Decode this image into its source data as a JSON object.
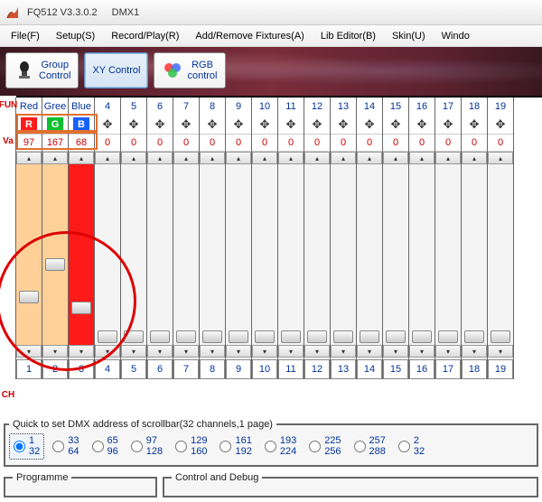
{
  "title": "FQ512 V3.3.0.2",
  "subtitle": "DMX1",
  "menu": {
    "file": "File(F)",
    "setup": "Setup(S)",
    "record": "Record/Play(R)",
    "fixtures": "Add/Remove Fixtures(A)",
    "libeditor": "Lib Editor(B)",
    "skin": "Skin(U)",
    "window": "Windo"
  },
  "toolbar": {
    "group": "Group\nControl",
    "xy": "XY Control",
    "rgb": "RGB\ncontrol"
  },
  "side_labels": {
    "fun": "FUN",
    "val": "Va",
    "ch": "CH"
  },
  "rgb_cols": [
    {
      "name": "Red",
      "letter": "R",
      "bg": "#ff1a1a",
      "value": "97",
      "thumb_pct": 70,
      "track_class": "orange"
    },
    {
      "name": "Gree",
      "letter": "G",
      "bg": "#0bbf2f",
      "value": "167",
      "thumb_pct": 52,
      "track_class": "orange"
    },
    {
      "name": "Blue",
      "letter": "B",
      "bg": "#1560ff",
      "value": "68",
      "thumb_pct": 76,
      "track_class": "red"
    }
  ],
  "num_cols": [
    {
      "n": "4",
      "v": "0"
    },
    {
      "n": "5",
      "v": "0"
    },
    {
      "n": "6",
      "v": "0"
    },
    {
      "n": "7",
      "v": "0"
    },
    {
      "n": "8",
      "v": "0"
    },
    {
      "n": "9",
      "v": "0"
    },
    {
      "n": "10",
      "v": "0"
    },
    {
      "n": "11",
      "v": "0"
    },
    {
      "n": "12",
      "v": "0"
    },
    {
      "n": "13",
      "v": "0"
    },
    {
      "n": "14",
      "v": "0"
    },
    {
      "n": "15",
      "v": "0"
    },
    {
      "n": "16",
      "v": "0"
    },
    {
      "n": "17",
      "v": "0"
    },
    {
      "n": "18",
      "v": "0"
    },
    {
      "n": "19",
      "v": "0"
    }
  ],
  "ch_row": [
    "1",
    "2",
    "3",
    "4",
    "5",
    "6",
    "7",
    "8",
    "9",
    "10",
    "11",
    "12",
    "13",
    "14",
    "15",
    "16",
    "17",
    "18",
    "19"
  ],
  "dmx_panel": {
    "legend": "Quick to set DMX address of scrollbar(32 channels,1 page)",
    "options": [
      {
        "top": "1",
        "bot": "32",
        "sel": true
      },
      {
        "top": "33",
        "bot": "64",
        "sel": false
      },
      {
        "top": "65",
        "bot": "96",
        "sel": false
      },
      {
        "top": "97",
        "bot": "128",
        "sel": false
      },
      {
        "top": "129",
        "bot": "160",
        "sel": false
      },
      {
        "top": "161",
        "bot": "192",
        "sel": false
      },
      {
        "top": "193",
        "bot": "224",
        "sel": false
      },
      {
        "top": "225",
        "bot": "256",
        "sel": false
      },
      {
        "top": "257",
        "bot": "288",
        "sel": false
      },
      {
        "top": "2",
        "bot": "32",
        "sel": false
      }
    ]
  },
  "bottom": {
    "programme": "Programme",
    "control": "Control and Debug"
  }
}
